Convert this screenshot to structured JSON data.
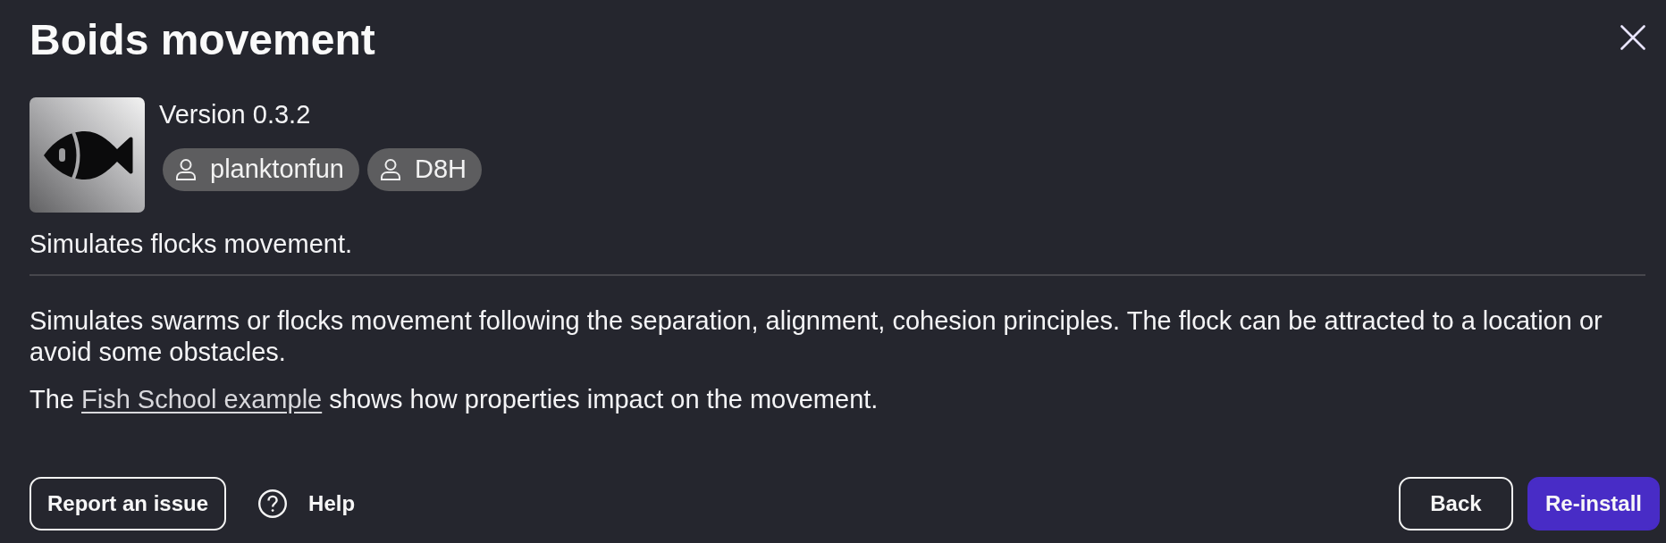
{
  "dialog": {
    "title": "Boids movement"
  },
  "extension": {
    "version": "Version 0.3.2",
    "authors": [
      "planktonfun",
      "D8H"
    ],
    "short_description": "Simulates flocks movement."
  },
  "description": [
    {
      "parts": [
        {
          "kind": "text",
          "text": "Simulates swarms or flocks movement following the separation, alignment, cohesion principles. The flock can be attracted to a location or avoid some obstacles."
        }
      ]
    },
    {
      "parts": [
        {
          "kind": "text",
          "text": "The "
        },
        {
          "kind": "link",
          "text": "Fish School example"
        },
        {
          "kind": "text",
          "text": " shows how properties impact on the movement."
        }
      ]
    }
  ],
  "footer": {
    "left_buttons": [
      {
        "label": "Report an issue",
        "kind": "outlined"
      },
      {
        "label": "Help",
        "kind": "help"
      }
    ],
    "right_buttons": [
      {
        "label": "Back",
        "kind": "outlined"
      },
      {
        "label": "Re-install",
        "kind": "primary"
      }
    ]
  }
}
